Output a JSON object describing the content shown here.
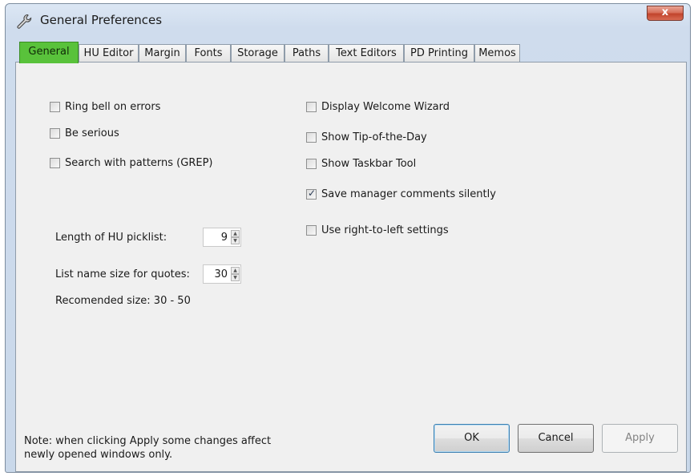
{
  "window": {
    "title": "General Preferences",
    "close_label": "x",
    "icon": "wrench-icon"
  },
  "tabs": [
    {
      "label": "General",
      "active": true
    },
    {
      "label": "HU Editor",
      "active": false
    },
    {
      "label": "Margin",
      "active": false
    },
    {
      "label": "Fonts",
      "active": false
    },
    {
      "label": "Storage",
      "active": false
    },
    {
      "label": "Paths",
      "active": false
    },
    {
      "label": "Text Editors",
      "active": false
    },
    {
      "label": "PD Printing",
      "active": false
    },
    {
      "label": "Memos",
      "active": false
    }
  ],
  "left_options": [
    {
      "label": "Ring bell on errors",
      "checked": false
    },
    {
      "label": "Be serious",
      "checked": false
    },
    {
      "label": "Search with patterns (GREP)",
      "checked": false
    }
  ],
  "right_options": [
    {
      "label": "Display Welcome Wizard",
      "checked": false
    },
    {
      "label": "Show Tip-of-the-Day",
      "checked": false
    },
    {
      "label": "Show Taskbar Tool",
      "checked": false
    },
    {
      "label": "Save manager comments silently",
      "checked": true
    },
    {
      "label": "Use right-to-left settings",
      "checked": false
    }
  ],
  "picklist": {
    "label": "Length of HU picklist:",
    "value": "9"
  },
  "quotes": {
    "label": "List name size for quotes:",
    "value": "30"
  },
  "recommended": "Recomended size: 30 - 50",
  "note_line1": "Note: when clicking Apply some changes affect",
  "note_line2": "newly opened windows only.",
  "buttons": {
    "ok": "OK",
    "cancel": "Cancel",
    "apply": "Apply"
  },
  "colors": {
    "active_tab": "#59c23b",
    "close_button": "#c2442c"
  }
}
